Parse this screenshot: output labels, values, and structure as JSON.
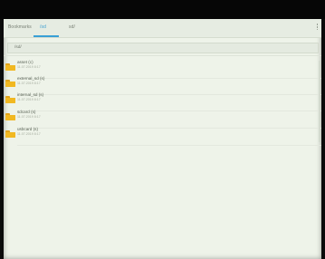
{
  "tabs": [
    {
      "label": "Bookmarks",
      "active": false
    },
    {
      "label": "/sd",
      "active": true
    },
    {
      "label": "sd/",
      "active": false
    }
  ],
  "path": "/sd/",
  "items": [
    {
      "name": "asset (c)",
      "date": "11.07.2019 8:17"
    },
    {
      "name": "external_sd (s)",
      "date": "11.07.2019 8:17"
    },
    {
      "name": "internal_sd (s)",
      "date": "11.07.2019 8:17"
    },
    {
      "name": "sdcard (s)",
      "date": "11.07.2019 8:17"
    },
    {
      "name": "usbcard (s)",
      "date": "11.07.2019 8:17"
    }
  ],
  "colors": {
    "accent": "#39a0d6",
    "folder": "#f1b822",
    "background": "#eef3e9"
  }
}
